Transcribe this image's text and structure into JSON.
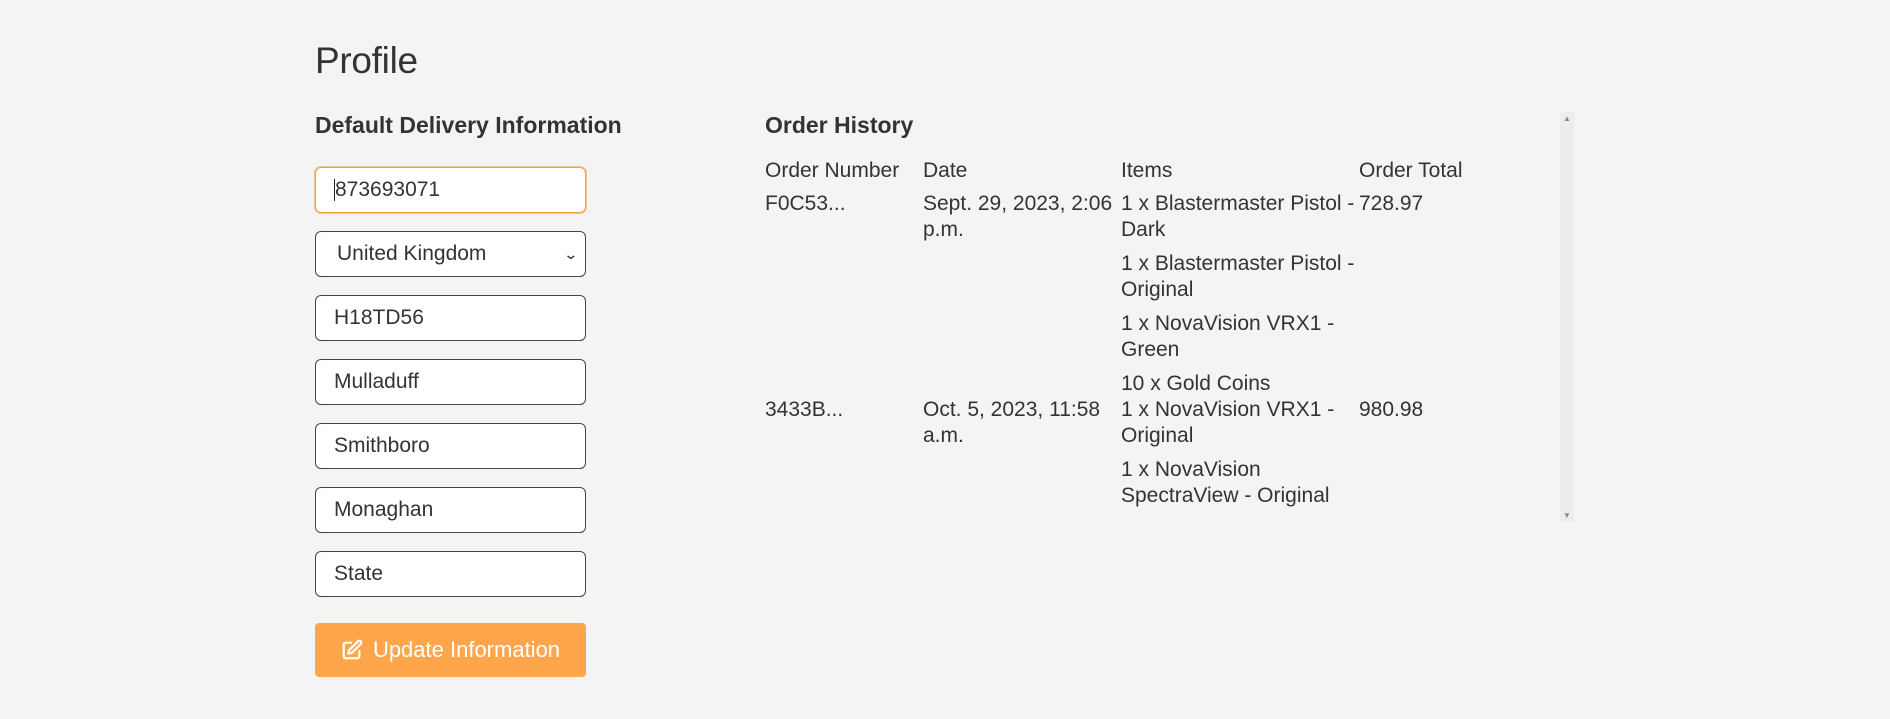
{
  "page": {
    "title": "Profile"
  },
  "delivery": {
    "title": "Default Delivery Information",
    "phone": "873693071",
    "country": "United Kingdom",
    "postcode": "H18TD56",
    "town": "Mulladuff",
    "street1": "Smithboro",
    "street2": "Monaghan",
    "county_placeholder": "State",
    "update_label": "Update Information"
  },
  "orders": {
    "title": "Order History",
    "headers": {
      "number": "Order Number",
      "date": "Date",
      "items": "Items",
      "total": "Order Total"
    },
    "rows": [
      {
        "number": "F0C53...",
        "date": "Sept. 29, 2023, 2:06 p.m.",
        "items": [
          "1 x Blastermaster Pistol - Dark",
          "1 x Blastermaster Pistol - Original",
          "1 x NovaVision VRX1 - Green",
          "10 x Gold Coins"
        ],
        "total": "728.97"
      },
      {
        "number": "3433B...",
        "date": "Oct. 5, 2023, 11:58 a.m.",
        "items": [
          "1 x NovaVision VRX1 - Original",
          "1 x NovaVision SpectraView - Original"
        ],
        "total": "980.98"
      }
    ]
  },
  "icons": {
    "update": "edit-icon",
    "select": "chevron-down-icon"
  },
  "colors": {
    "accent": "#ffa64d",
    "focus_border": "#f0a24b",
    "background": "#f4f4f4"
  }
}
